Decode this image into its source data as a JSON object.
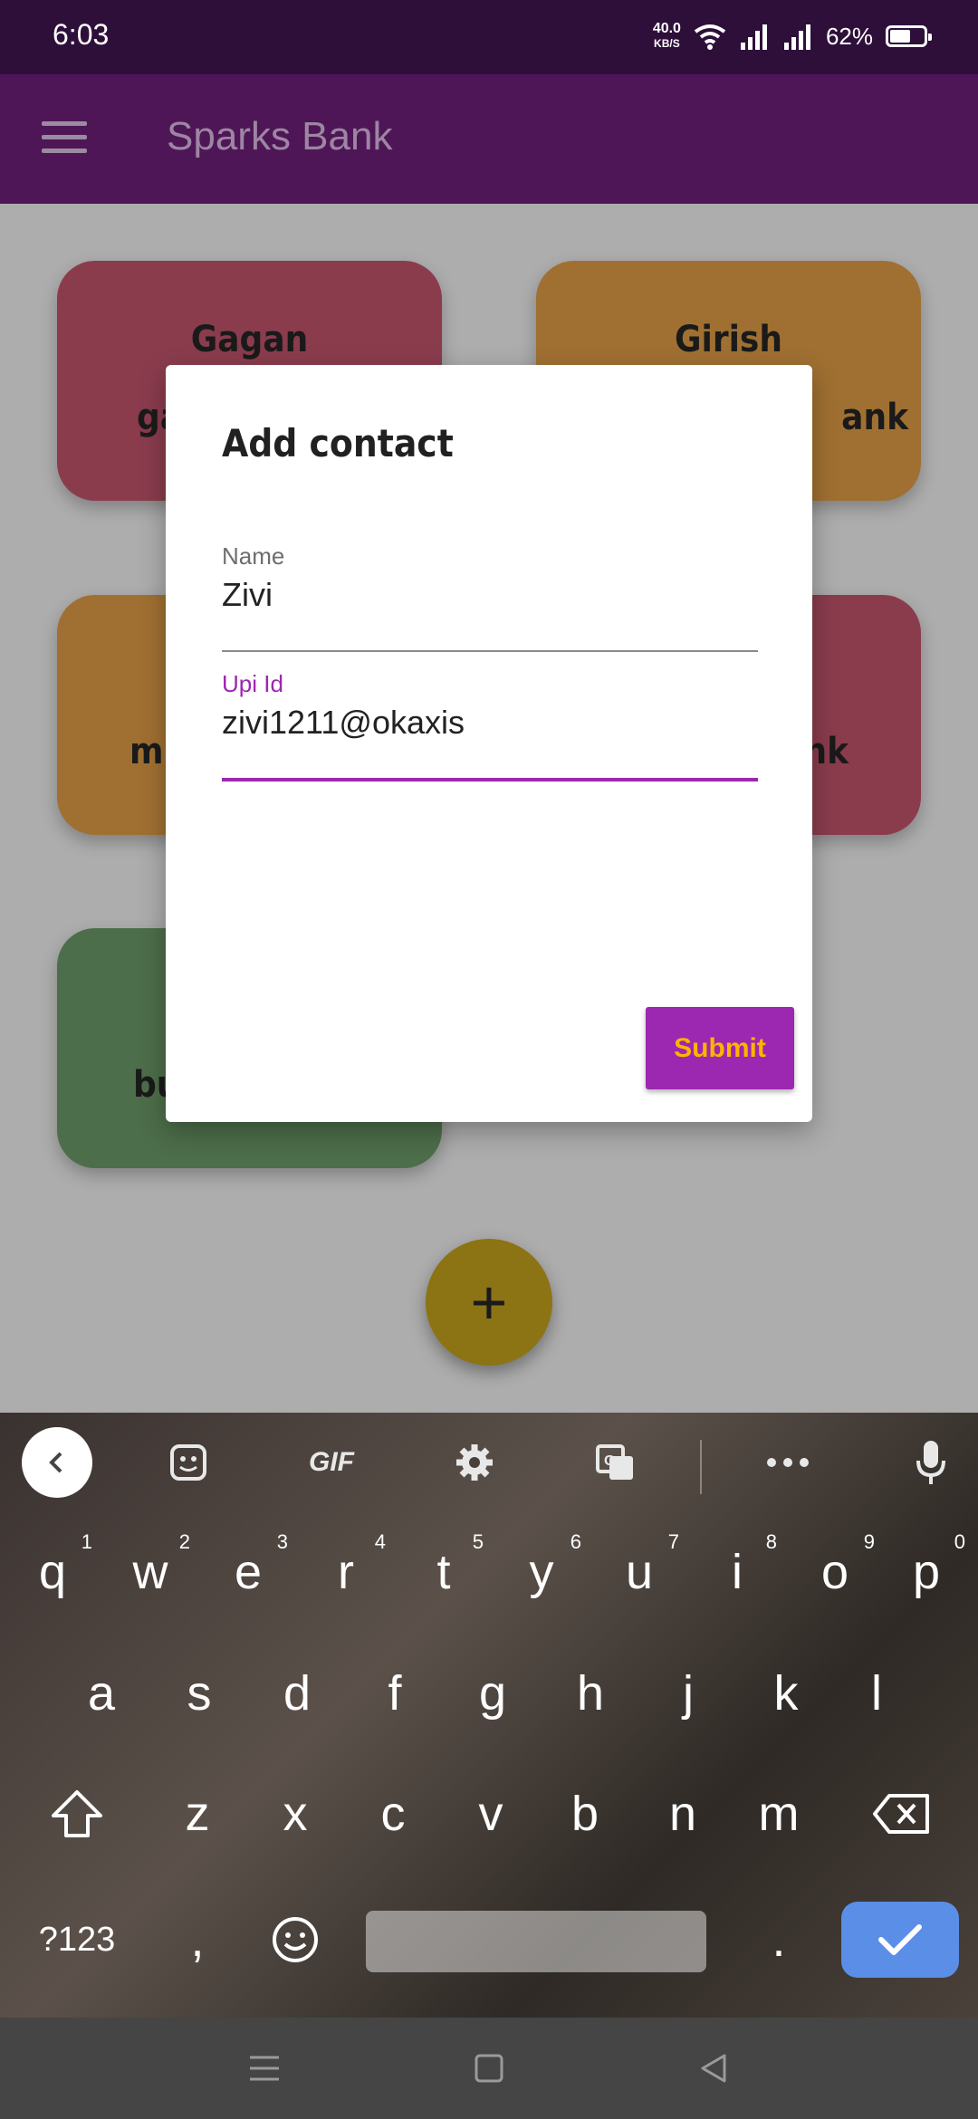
{
  "status_bar": {
    "time": "6:03",
    "net_speed_value": "40.0",
    "net_speed_unit": "KB/S",
    "battery_percent": "62%",
    "battery_level": 0.62
  },
  "app_bar": {
    "title": "Sparks Bank",
    "menu_icon": "menu-icon"
  },
  "contacts": [
    {
      "line1": "Gagan",
      "line2": "ga",
      "color": "pink"
    },
    {
      "line1": "Girish",
      "line2": "ank",
      "color": "orange"
    },
    {
      "line1": "",
      "line2": "mu",
      "color": "orange"
    },
    {
      "line1": "",
      "line2": "nk",
      "color": "pink"
    },
    {
      "line1": "",
      "line2": "bu",
      "color": "green"
    }
  ],
  "fab": {
    "label": "+"
  },
  "dialog": {
    "title": "Add contact",
    "name_label": "Name",
    "name_value": "Zivi",
    "upi_label": "Upi Id",
    "upi_value": "zivi1211@okaxis",
    "submit_label": "Submit",
    "accent_color": "#9c27b0",
    "submit_text_color": "#ffb300"
  },
  "keyboard": {
    "toolbar": [
      "back-icon",
      "sticker-icon",
      "GIF",
      "gear-icon",
      "translate-icon",
      "more-icon",
      "mic-icon"
    ],
    "row1": [
      {
        "k": "q",
        "n": "1"
      },
      {
        "k": "w",
        "n": "2"
      },
      {
        "k": "e",
        "n": "3"
      },
      {
        "k": "r",
        "n": "4"
      },
      {
        "k": "t",
        "n": "5"
      },
      {
        "k": "y",
        "n": "6"
      },
      {
        "k": "u",
        "n": "7"
      },
      {
        "k": "i",
        "n": "8"
      },
      {
        "k": "o",
        "n": "9"
      },
      {
        "k": "p",
        "n": "0"
      }
    ],
    "row2": [
      "a",
      "s",
      "d",
      "f",
      "g",
      "h",
      "j",
      "k",
      "l"
    ],
    "row3": [
      "z",
      "x",
      "c",
      "v",
      "b",
      "n",
      "m"
    ],
    "symbols_key": "?123",
    "comma_key": ",",
    "period_key": "."
  },
  "nav_bar": {
    "buttons": [
      "recents-icon",
      "home-icon",
      "back-icon"
    ]
  }
}
